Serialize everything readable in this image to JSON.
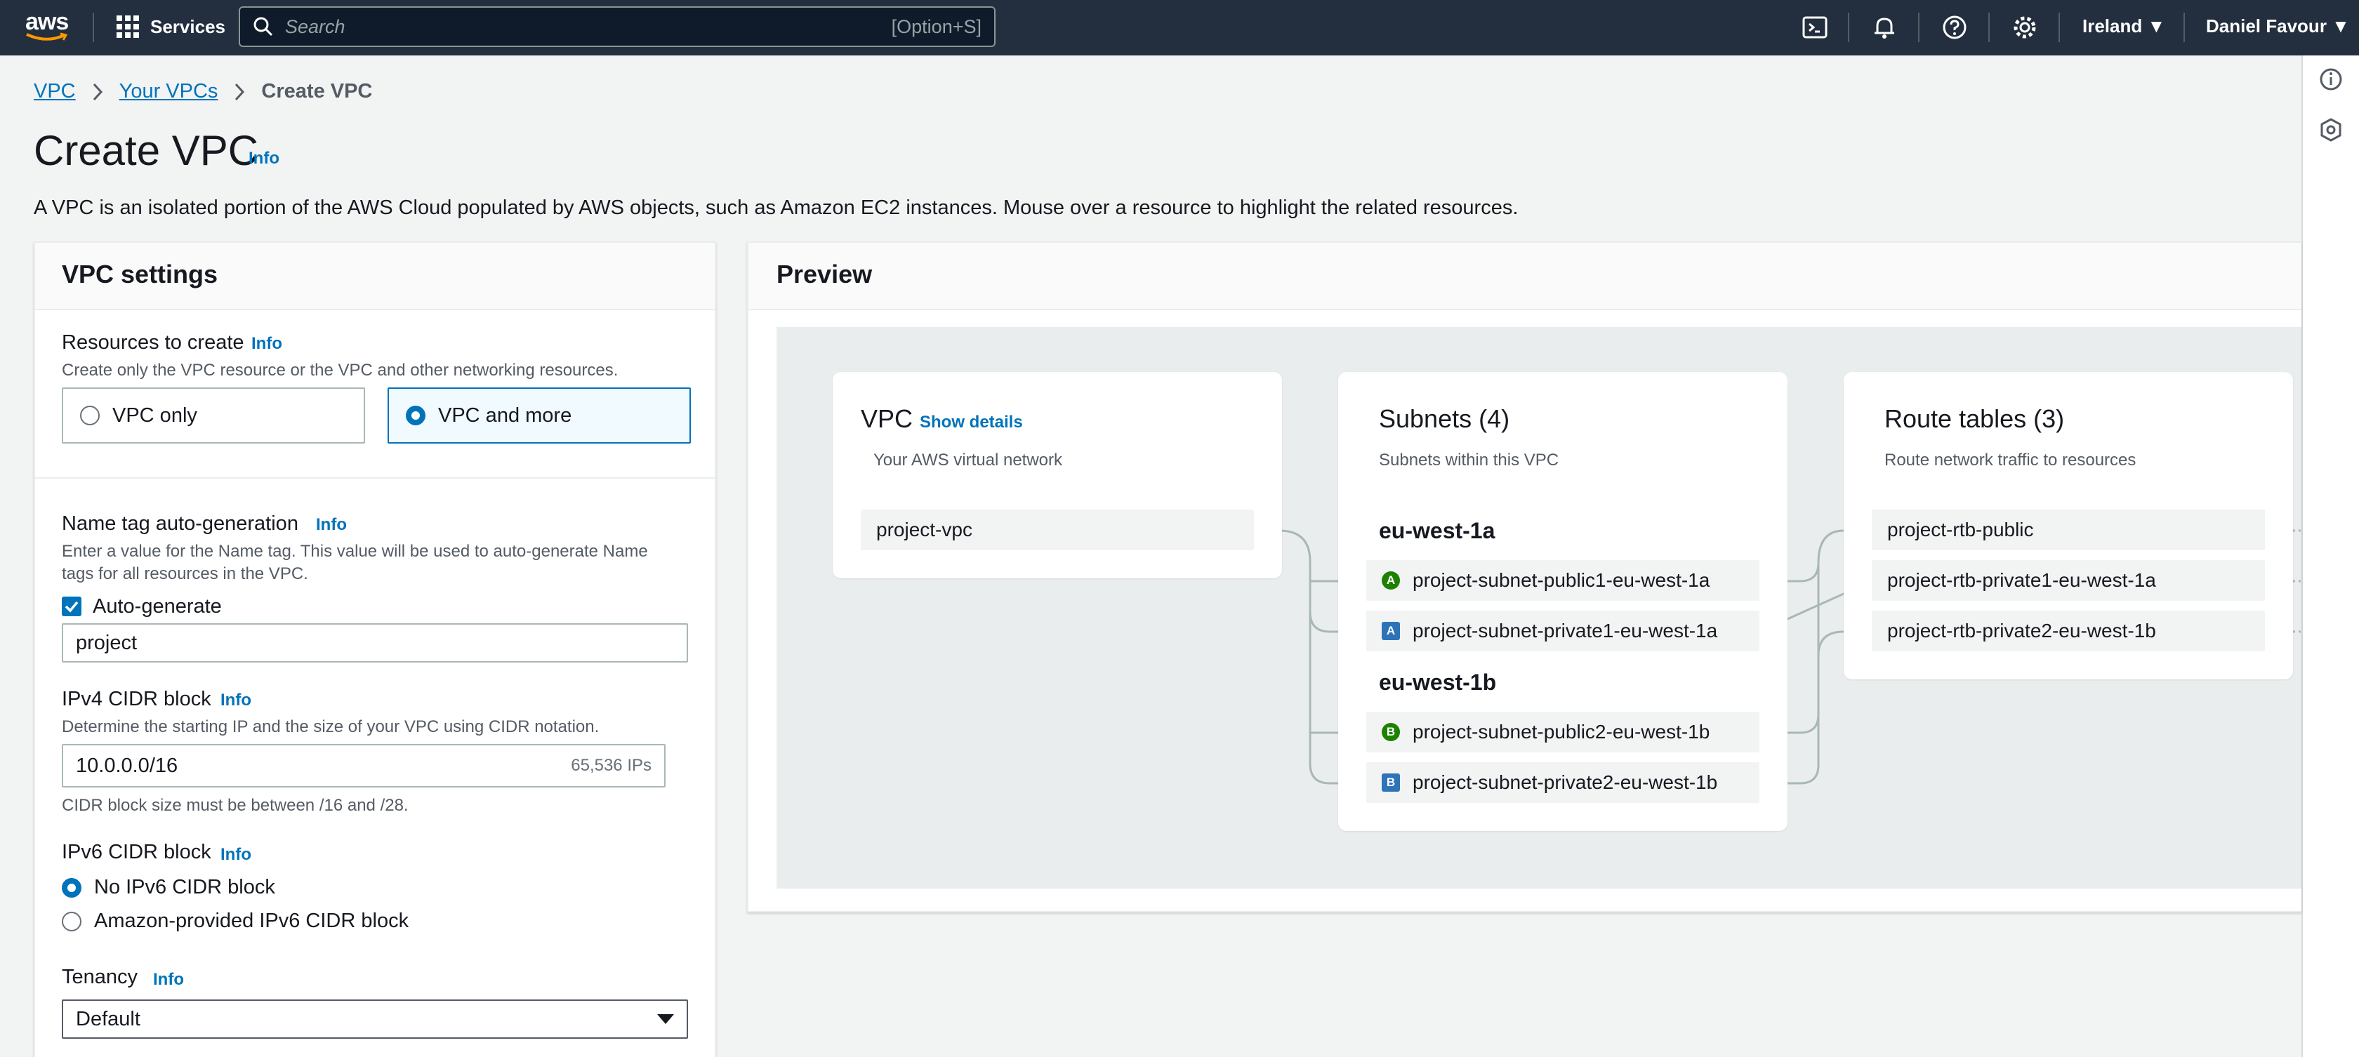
{
  "topnav": {
    "logo": "aws",
    "services": "Services",
    "search_placeholder": "Search",
    "search_shortcut": "[Option+S]",
    "region": "Ireland",
    "user": "Daniel Favour",
    "icons": [
      "cloudshell-icon",
      "bell-icon",
      "help-icon",
      "settings-icon"
    ]
  },
  "breadcrumb": {
    "items": [
      "VPC",
      "Your VPCs"
    ],
    "current": "Create VPC"
  },
  "page": {
    "title": "Create VPC",
    "info": "Info",
    "description": "A VPC is an isolated portion of the AWS Cloud populated by AWS objects, such as Amazon EC2 instances. Mouse over a resource to highlight the related resources."
  },
  "settings": {
    "heading": "VPC settings",
    "resources": {
      "label": "Resources to create",
      "info": "Info",
      "description": "Create only the VPC resource or the VPC and other networking resources.",
      "options": [
        "VPC only",
        "VPC and more"
      ],
      "selected": "VPC and more"
    },
    "name_tag": {
      "label": "Name tag auto-generation",
      "info": "Info",
      "description_line1": "Enter a value for the Name tag. This value will be used to auto-generate Name",
      "description_line2": "tags for all resources in the VPC.",
      "checkbox_label": "Auto-generate",
      "checked": true,
      "value": "project"
    },
    "ipv4": {
      "label": "IPv4 CIDR block",
      "info": "Info",
      "description": "Determine the starting IP and the size of your VPC using CIDR notation.",
      "value": "10.0.0.0/16",
      "hint": "65,536 IPs",
      "constraint": "CIDR block size must be between /16 and /28."
    },
    "ipv6": {
      "label": "IPv6 CIDR block",
      "info": "Info",
      "options": [
        "No IPv6 CIDR block",
        "Amazon-provided IPv6 CIDR block"
      ],
      "selected": "No IPv6 CIDR block"
    },
    "tenancy": {
      "label": "Tenancy",
      "info": "Info",
      "value": "Default"
    }
  },
  "preview": {
    "heading": "Preview",
    "vpc": {
      "title": "VPC",
      "link": "Show details",
      "subtitle": "Your AWS virtual network",
      "item": "project-vpc"
    },
    "subnets": {
      "title": "Subnets (4)",
      "subtitle": "Subnets within this VPC",
      "zones": [
        {
          "name": "eu-west-1a",
          "items": [
            {
              "badge": "A",
              "kind": "public",
              "name": "project-subnet-public1-eu-west-1a"
            },
            {
              "badge": "A",
              "kind": "private",
              "name": "project-subnet-private1-eu-west-1a"
            }
          ]
        },
        {
          "name": "eu-west-1b",
          "items": [
            {
              "badge": "B",
              "kind": "public",
              "name": "project-subnet-public2-eu-west-1b"
            },
            {
              "badge": "B",
              "kind": "private",
              "name": "project-subnet-private2-eu-west-1b"
            }
          ]
        }
      ]
    },
    "route_tables": {
      "title": "Route tables (3)",
      "subtitle": "Route network traffic to resources",
      "items": [
        "project-rtb-public",
        "project-rtb-private1-eu-west-1a",
        "project-rtb-private2-eu-west-1b"
      ]
    }
  },
  "colors": {
    "nav": "#232f3e",
    "link": "#0073bb",
    "public_badge": "#1d8102",
    "private_badge": "#2e73b8"
  }
}
